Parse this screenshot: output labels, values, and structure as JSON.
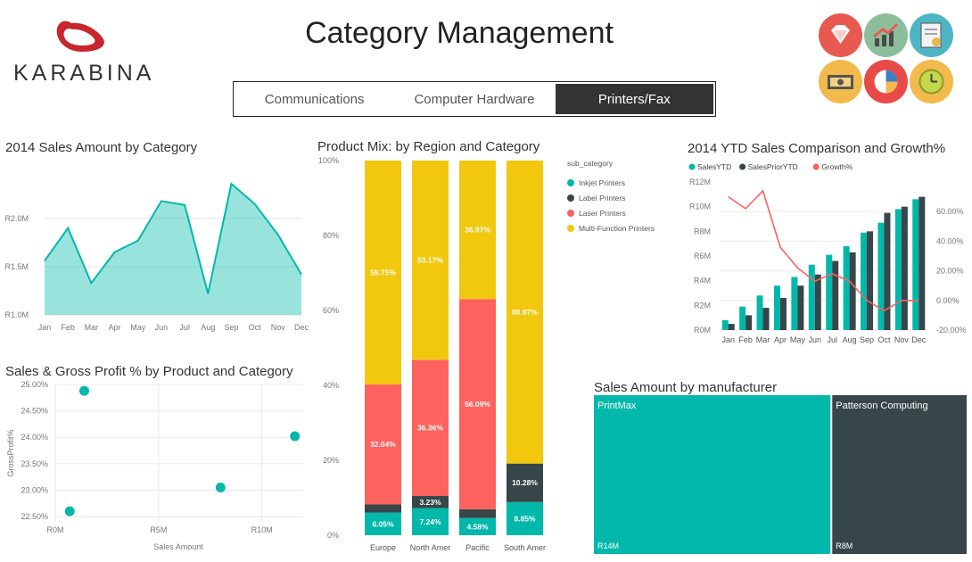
{
  "header": {
    "title": "Category Management",
    "logo_text": "KARABINA",
    "tabs": [
      "Communications",
      "Computer Hardware",
      "Printers/Fax"
    ],
    "active_tab": 2
  },
  "icons": [
    "diamond-icon",
    "growth-chart-icon",
    "certificate-icon",
    "money-icon",
    "pie-chart-icon",
    "clock-icon"
  ],
  "chart_data": [
    {
      "id": "sales-by-category",
      "type": "area",
      "title": "2014 Sales Amount by Category",
      "categories": [
        "Jan",
        "Feb",
        "Mar",
        "Apr",
        "May",
        "Jun",
        "Jul",
        "Aug",
        "Sep",
        "Oct",
        "Nov",
        "Dec"
      ],
      "values": [
        1.56,
        1.9,
        1.33,
        1.65,
        1.77,
        2.18,
        2.14,
        1.22,
        2.36,
        2.15,
        1.83,
        1.42
      ],
      "ylim": [
        1.0,
        2.6
      ],
      "y_ticks": [
        1.0,
        1.5,
        2.0
      ],
      "y_tick_labels": [
        "R1.0M",
        "R1.5M",
        "R2.0M"
      ],
      "color": "#01B8AA"
    },
    {
      "id": "sales-gross-profit",
      "type": "scatter",
      "title": "Sales & Gross Profit % by Product and Category",
      "xlabel": "Sales Amount",
      "ylabel": "GrossProfit%",
      "xlim": [
        0,
        12
      ],
      "ylim": [
        22.4,
        25.0
      ],
      "x_ticks": [
        0,
        5,
        10
      ],
      "x_tick_labels": [
        "R0M",
        "R5M",
        "R10M"
      ],
      "y_ticks": [
        22.5,
        23.0,
        23.5,
        24.0,
        24.5,
        25.0
      ],
      "y_tick_labels": [
        "22.50%",
        "23.00%",
        "23.50%",
        "24.00%",
        "24.50%",
        "25.00%"
      ],
      "points": [
        {
          "x": 0.7,
          "y": 22.6
        },
        {
          "x": 1.4,
          "y": 24.88
        },
        {
          "x": 8.0,
          "y": 23.05
        },
        {
          "x": 11.6,
          "y": 24.02
        }
      ],
      "color": "#01B8AA"
    },
    {
      "id": "product-mix",
      "type": "bar",
      "stacked": "100%",
      "title": "Product Mix: by Region and Category",
      "categories": [
        "Europe",
        "North Amer",
        "Pacific",
        "South Amer"
      ],
      "legend_title": "sub_category",
      "legend_position": "top-right",
      "y_ticks": [
        0,
        20,
        40,
        60,
        80,
        100
      ],
      "y_tick_labels": [
        "0%",
        "20%",
        "40%",
        "60%",
        "80%",
        "100%"
      ],
      "series": [
        {
          "name": "Inkjet Printers",
          "color": "#01B8AA",
          "values": [
            6.05,
            7.24,
            4.58,
            8.85
          ],
          "labels": [
            "6.05%",
            "7.24%",
            "4.58%",
            "8.85%"
          ]
        },
        {
          "name": "Label Printers",
          "color": "#374649",
          "values": [
            2.16,
            3.23,
            2.36,
            10.28
          ],
          "labels": [
            "",
            "3.23%",
            "",
            "10.28%"
          ]
        },
        {
          "name": "Laser Printers",
          "color": "#FD625E",
          "values": [
            32.04,
            36.36,
            56.09,
            0
          ],
          "labels": [
            "32.04%",
            "36.36%",
            "56.09%",
            ""
          ]
        },
        {
          "name": "Multi-Function Printers",
          "color": "#F2C80F",
          "values": [
            59.75,
            53.17,
            36.97,
            80.87
          ],
          "labels": [
            "59.75%",
            "53.17%",
            "36.97%",
            "80.87%"
          ]
        }
      ]
    },
    {
      "id": "ytd-comparison",
      "type": "bar",
      "title": "2014 YTD Sales Comparison and Growth%",
      "categories": [
        "Jan",
        "Feb",
        "Mar",
        "Apr",
        "May",
        "Jun",
        "Jul",
        "Aug",
        "Sep",
        "Oct",
        "Nov",
        "Dec"
      ],
      "legend_position": "top-left",
      "ylim": [
        0,
        12
      ],
      "y_ticks": [
        0,
        2,
        4,
        6,
        8,
        10,
        12
      ],
      "y_tick_labels": [
        "R0M",
        "R2M",
        "R4M",
        "R6M",
        "R8M",
        "R10M",
        "R12M"
      ],
      "y2lim": [
        -20,
        80
      ],
      "y2_ticks": [
        -20,
        0,
        20,
        40,
        60
      ],
      "y2_tick_labels": [
        "-20.00%",
        "0.00%",
        "20.00%",
        "40.00%",
        "60.00%"
      ],
      "series": [
        {
          "name": "SalesYTD",
          "color": "#01B8AA",
          "type": "bar",
          "values": [
            0.8,
            1.9,
            2.8,
            3.6,
            4.3,
            5.3,
            6.1,
            6.8,
            7.9,
            8.7,
            9.8,
            10.6
          ]
        },
        {
          "name": "SalesPriorYTD",
          "color": "#374649",
          "type": "bar",
          "values": [
            0.5,
            1.2,
            1.8,
            2.6,
            3.6,
            4.5,
            5.6,
            6.3,
            8.0,
            9.5,
            10.0,
            10.8
          ]
        },
        {
          "name": "Growth%",
          "color": "#FD625E",
          "type": "line",
          "axis": "y2",
          "values": [
            70,
            62,
            74,
            36,
            22,
            13,
            18,
            13,
            0,
            -7,
            0,
            0
          ]
        }
      ]
    },
    {
      "id": "sales-by-manufacturer",
      "type": "treemap",
      "title": "Sales Amount by manufacturer",
      "items": [
        {
          "name": "PrintMax",
          "value": 14,
          "label": "R14M",
          "color": "#01B8AA"
        },
        {
          "name": "Patterson Computing",
          "value": 8,
          "label": "R8M",
          "color": "#374649"
        }
      ]
    }
  ]
}
